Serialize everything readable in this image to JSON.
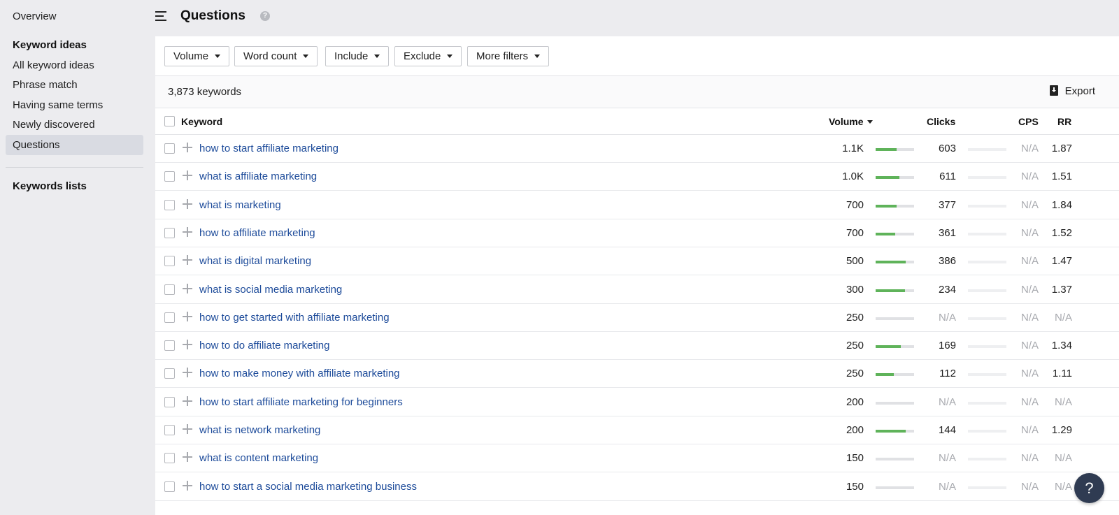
{
  "sidebar": {
    "overview": "Overview",
    "heading_ideas": "Keyword ideas",
    "items": [
      "All keyword ideas",
      "Phrase match",
      "Having same terms",
      "Newly discovered",
      "Questions"
    ],
    "active_index": 4,
    "heading_lists": "Keywords lists"
  },
  "header": {
    "title": "Questions",
    "help_glyph": "?"
  },
  "filters": [
    "Volume",
    "Word count",
    "Include",
    "Exclude",
    "More filters"
  ],
  "summary": {
    "count": "3,873 keywords",
    "export_label": "Export"
  },
  "columns": {
    "keyword": "Keyword",
    "volume": "Volume",
    "clicks": "Clicks",
    "cps": "CPS",
    "rr": "RR"
  },
  "rows": [
    {
      "keyword": "how to start affiliate marketing",
      "volume": "1.1K",
      "volume_level": 0.55,
      "clicks": "603",
      "cps": "N/A",
      "rr": "1.87"
    },
    {
      "keyword": "what is affiliate marketing",
      "volume": "1.0K",
      "volume_level": 0.62,
      "clicks": "611",
      "cps": "N/A",
      "rr": "1.51"
    },
    {
      "keyword": "what is marketing",
      "volume": "700",
      "volume_level": 0.55,
      "clicks": "377",
      "cps": "N/A",
      "rr": "1.84"
    },
    {
      "keyword": "how to affiliate marketing",
      "volume": "700",
      "volume_level": 0.5,
      "clicks": "361",
      "cps": "N/A",
      "rr": "1.52"
    },
    {
      "keyword": "what is digital marketing",
      "volume": "500",
      "volume_level": 0.78,
      "clicks": "386",
      "cps": "N/A",
      "rr": "1.47"
    },
    {
      "keyword": "what is social media marketing",
      "volume": "300",
      "volume_level": 0.76,
      "clicks": "234",
      "cps": "N/A",
      "rr": "1.37"
    },
    {
      "keyword": "how to get started with affiliate marketing",
      "volume": "250",
      "volume_level": 0,
      "clicks": "N/A",
      "cps": "N/A",
      "rr": "N/A"
    },
    {
      "keyword": "how to do affiliate marketing",
      "volume": "250",
      "volume_level": 0.65,
      "clicks": "169",
      "cps": "N/A",
      "rr": "1.34"
    },
    {
      "keyword": "how to make money with affiliate marketing",
      "volume": "250",
      "volume_level": 0.48,
      "clicks": "112",
      "cps": "N/A",
      "rr": "1.11"
    },
    {
      "keyword": "how to start affiliate marketing for beginners",
      "volume": "200",
      "volume_level": 0,
      "clicks": "N/A",
      "cps": "N/A",
      "rr": "N/A"
    },
    {
      "keyword": "what is network marketing",
      "volume": "200",
      "volume_level": 0.78,
      "clicks": "144",
      "cps": "N/A",
      "rr": "1.29"
    },
    {
      "keyword": "what is content marketing",
      "volume": "150",
      "volume_level": 0,
      "clicks": "N/A",
      "cps": "N/A",
      "rr": "N/A"
    },
    {
      "keyword": "how to start a social media marketing business",
      "volume": "150",
      "volume_level": 0,
      "clicks": "N/A",
      "cps": "N/A",
      "rr": "N/A"
    }
  ],
  "help_fab": "?",
  "colors": {
    "link": "#1d4b9a",
    "bar_fill": "#5fb35a",
    "na_text": "#a8aaaf",
    "fab": "#2f3b52"
  }
}
